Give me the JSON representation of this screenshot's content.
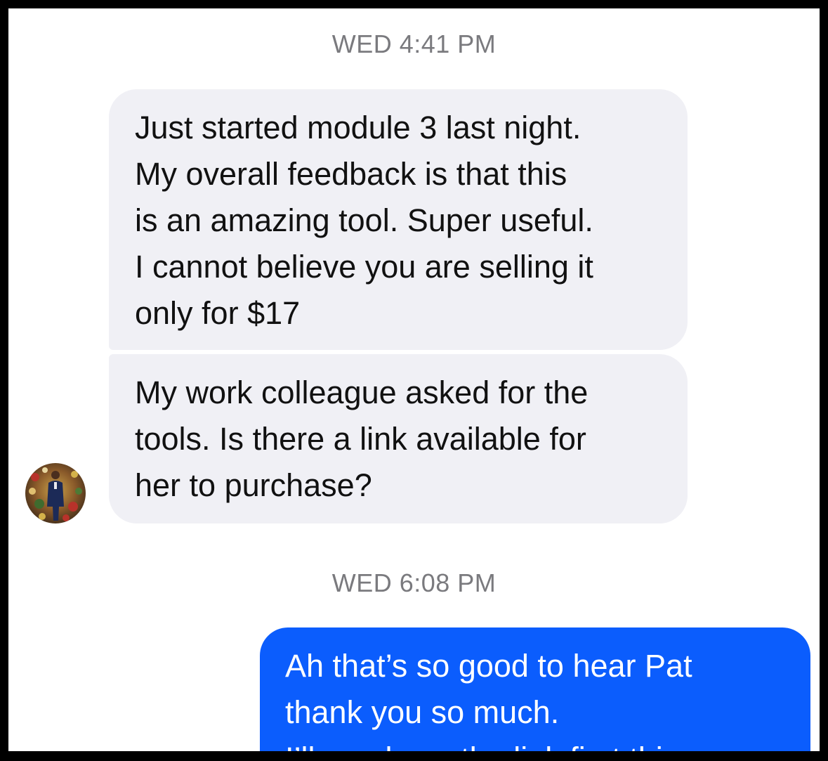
{
  "conversation": {
    "groups": [
      {
        "timestamp": "WED 4:41 PM",
        "sender": "incoming",
        "messages": [
          {
            "lines": [
              "Just started module 3 last night.",
              "My overall feedback is that this",
              "is an amazing tool. Super useful.",
              "I cannot believe you are selling it",
              "only for $17"
            ]
          },
          {
            "lines": [
              "My work colleague asked for the",
              "tools. Is there a link available for",
              "her to purchase?"
            ]
          }
        ]
      },
      {
        "timestamp": "WED 6:08 PM",
        "sender": "outgoing",
        "messages": [
          {
            "lines": [
              "Ah that’s so good to hear Pat",
              "thank you so much.",
              "I’ll send you the link first thing"
            ]
          }
        ]
      }
    ]
  },
  "colors": {
    "incoming_bubble": "#f0f0f5",
    "outgoing_bubble": "#0b5dfd",
    "timestamp_text": "#7a7a7e"
  },
  "icons": {
    "avatar": "contact-avatar-photo"
  }
}
